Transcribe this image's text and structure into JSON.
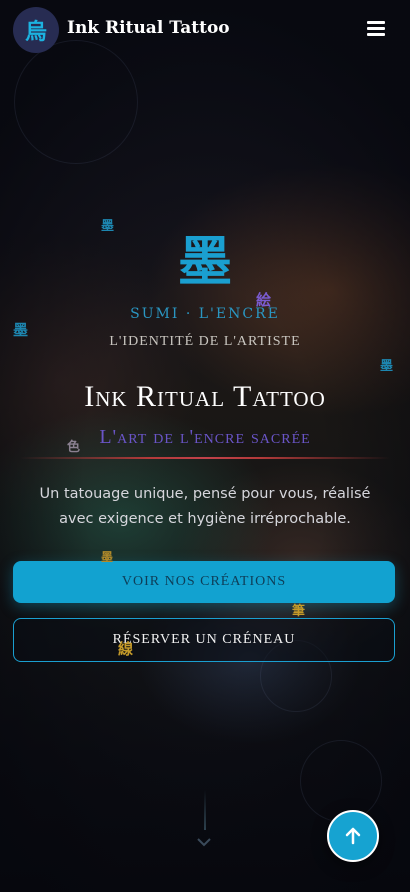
{
  "header": {
    "logo_glyph": "烏",
    "brand": "Ink Ritual Tattoo",
    "menu_icon": "hamburger-icon"
  },
  "hero": {
    "kanji": "墨",
    "kanji_caption": "SUMI · L'ENCRE",
    "identity": "L'IDENTITÉ DE L'ARTISTE",
    "title": "Ink Ritual Tattoo",
    "tagline": "L'art de l'encre sacrée",
    "description": "Un tatouage unique, pensé pour vous, réalisé avec exigence et hygiène irréprochable.",
    "primary_button": "VOIR NOS CRÉATIONS",
    "secondary_button": "RÉSERVER UN CRÉNEAU"
  },
  "floating_glyphs": [
    "墨",
    "絵",
    "墨",
    "墨",
    "色",
    "墨",
    "筆",
    "線"
  ],
  "scroll_top_icon": "arrow-up-icon",
  "colors": {
    "accent": "#12a2d0",
    "tagline": "#6a55c8",
    "divider": "#c0424a",
    "logo_bg": "#272c52"
  }
}
